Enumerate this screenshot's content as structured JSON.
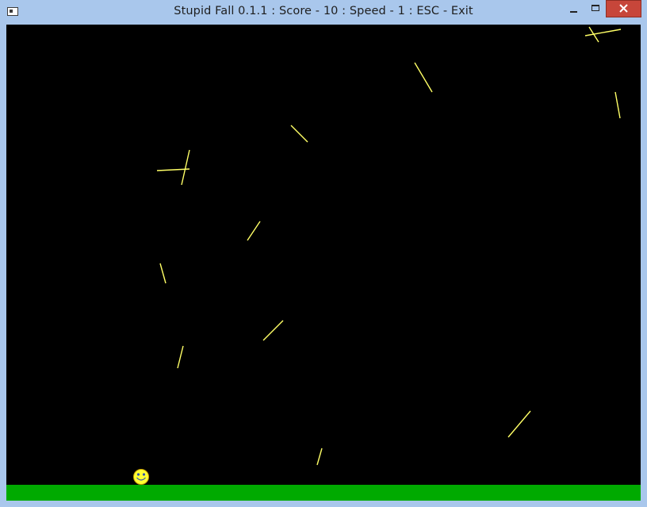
{
  "window": {
    "title": "Stupid Fall 0.1.1 : Score - 10 : Speed - 1 : ESC - Exit",
    "icons": {
      "app": "app-window-icon",
      "minimize": "minimize-icon",
      "maximize": "maximize-icon",
      "close": "close-icon"
    },
    "colors": {
      "titlebar": "#a9c7ec",
      "close_button": "#c7463a"
    }
  },
  "game": {
    "colors": {
      "background": "#000000",
      "ground": "#00aa00",
      "sticks": "#ffff66",
      "player": "#ffff33"
    },
    "player_icon": "smiley-face-icon"
  }
}
